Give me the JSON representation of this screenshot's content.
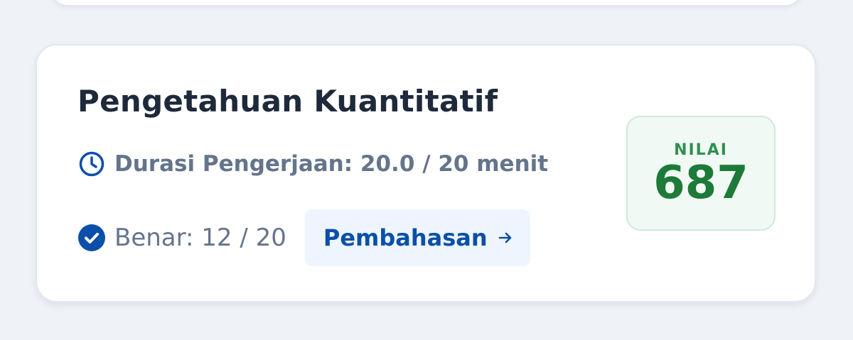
{
  "card": {
    "title": "Pengetahuan Kuantitatif",
    "duration_text": "Durasi Pengerjaan: 20.0 / 20 menit",
    "correct_text": "Benar: 12 / 20",
    "discussion_button_label": "Pembahasan",
    "score": {
      "label": "NILAI",
      "value": "687"
    }
  },
  "icons": {
    "duration": "clock-icon",
    "correct": "check-circle-icon",
    "discussion": "arrow-right-icon"
  },
  "colors": {
    "accent_blue": "#0b4fa8",
    "score_green": "#1d7a38",
    "muted_text": "#64748b",
    "title_text": "#1e293b"
  }
}
